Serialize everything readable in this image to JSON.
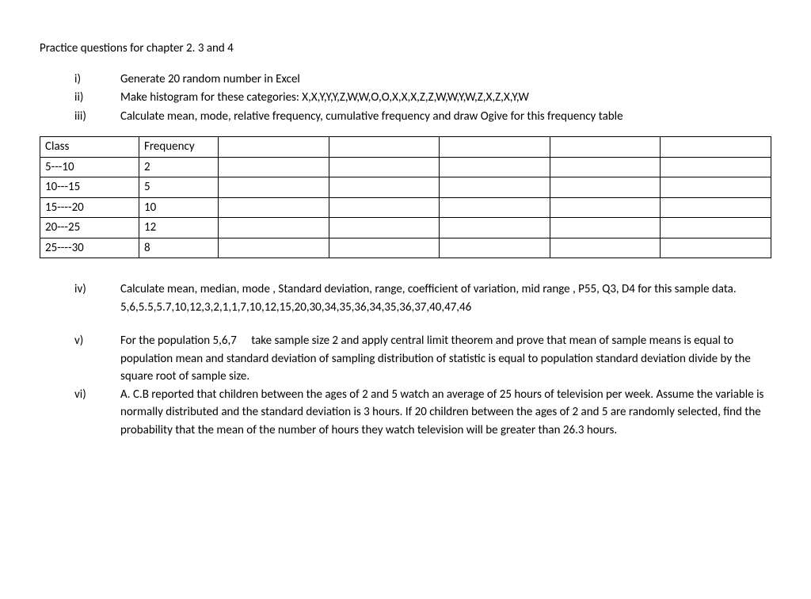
{
  "title": "Practice questions for chapter 2. 3 and 4",
  "upper_list": [
    {
      "num": "i)",
      "text": "Generate 20 random number in Excel"
    },
    {
      "num": "ii)",
      "text": "Make histogram for these categories: X,X,Y,Y,Y,Z,W,W,O,O,X,X,X,Z,Z,W,W,Y,W,Z,X,Z,X,Y,W"
    },
    {
      "num": "iii)",
      "text": "Calculate mean, mode, relative frequency, cumulative frequency and draw Ogive for this frequency table"
    }
  ],
  "table": {
    "headers": [
      "Class",
      "Frequency"
    ],
    "rows": [
      [
        "5---10",
        "2"
      ],
      [
        "10---15",
        "5"
      ],
      [
        "15----20",
        "10"
      ],
      [
        "20---25",
        "12"
      ],
      [
        "25----30",
        "8"
      ]
    ]
  },
  "lower_list": [
    {
      "num": "iv)",
      "text": "Calculate mean, median, mode , Standard deviation, range, coefficient of variation, mid range , P55, Q3, D4 for this sample data.",
      "extra": "5,6,5.5,5.7,10,12,3,2,1,1,7,10,12,15,20,30,34,35,36,34,35,36,37,40,47,46"
    },
    {
      "num": "v)",
      "text": "For the population 5,6,7  take sample size 2 and apply central limit theorem and prove that mean of sample means is equal to population mean and standard deviation of sampling distribution of statistic is equal to population standard deviation divide by the square root of sample size."
    },
    {
      "num": "vi)",
      "text": "A. C.B  reported that children between the ages of 2 and 5 watch an average of 25 hours of television per week. Assume the variable is normally distributed and the standard deviation is 3 hours. If 20 children between the ages of 2 and 5 are randomly selected, find the probability that the mean of the number of hours they watch television will be greater than 26.3 hours."
    }
  ]
}
